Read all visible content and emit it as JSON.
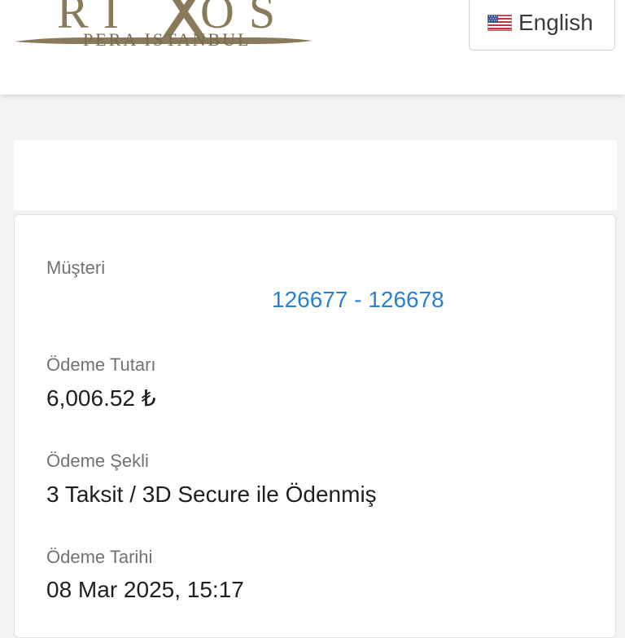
{
  "brand": {
    "logo_text": "RIXOS",
    "logo_subtitle": "PERA ISTANBUL",
    "gold": "#8a7a5c"
  },
  "language": {
    "label": "English",
    "flag_icon": "us-flag-icon"
  },
  "payment": {
    "customer_label": "Müşteri",
    "customer_value": "126677 - 126678",
    "amount_label": "Ödeme Tutarı",
    "amount_value": "6,006.52 ₺",
    "method_label": "Ödeme Şekli",
    "method_value": "3 Taksit / 3D Secure ile Ödenmiş",
    "date_label": "Ödeme Tarihi",
    "date_value": "08 Mar 2025, 15:17"
  },
  "colors": {
    "link": "#2a7fd0",
    "label": "#727272",
    "value": "#1f1f1f"
  }
}
